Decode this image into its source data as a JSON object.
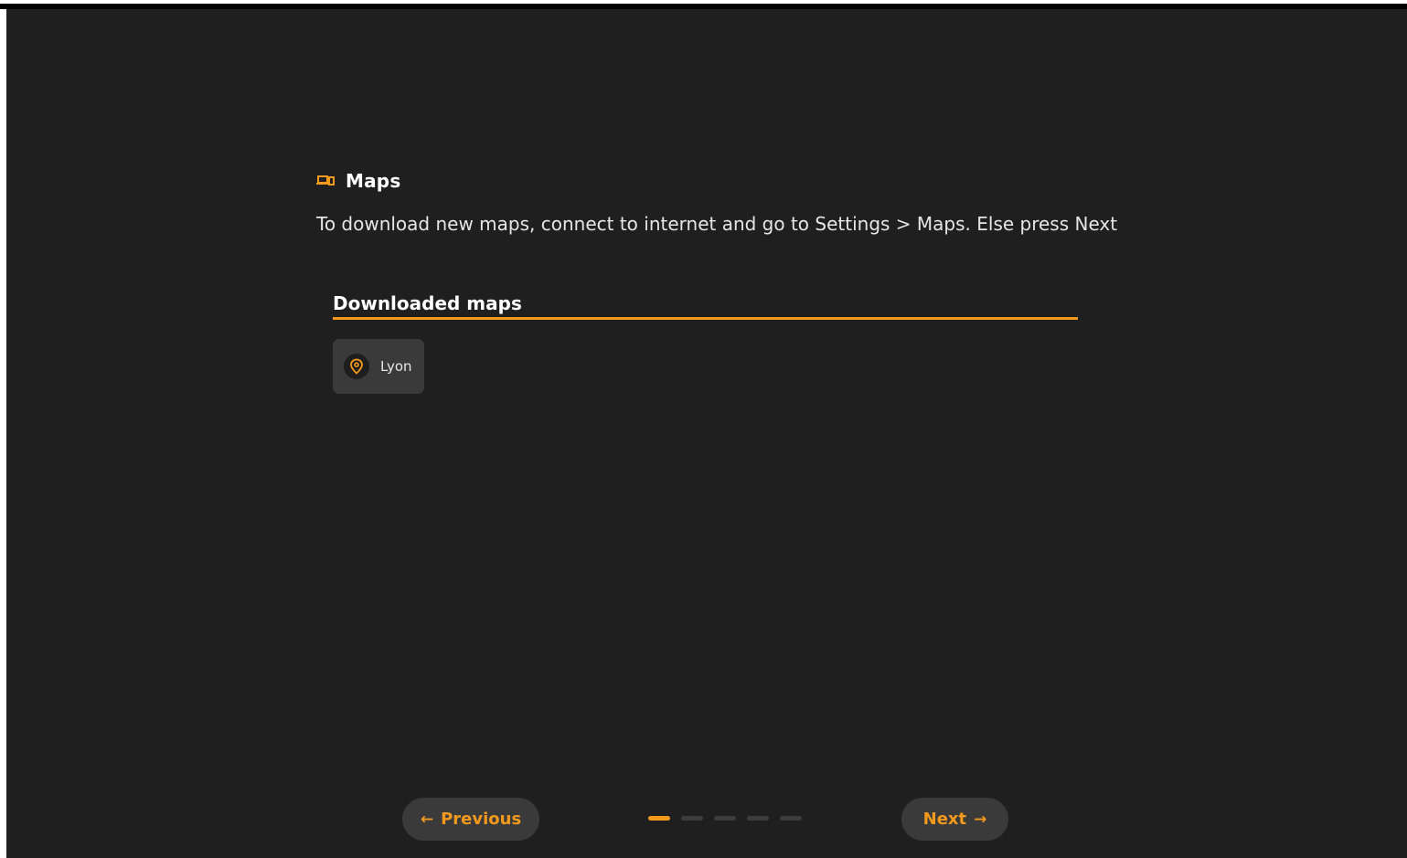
{
  "header": {
    "icon": "devices-icon",
    "title": "Maps"
  },
  "instructions": "To download new maps, connect to internet and go to Settings > Maps. Else press Next",
  "downloaded": {
    "title": "Downloaded maps",
    "items": [
      {
        "icon": "map-pin-icon",
        "label": "Lyon"
      }
    ]
  },
  "nav": {
    "previous_label": "Previous",
    "previous_icon": "arrow-left-icon",
    "previous_arrow": "←",
    "next_label": "Next",
    "next_icon": "arrow-right-icon",
    "next_arrow": "→",
    "steps_total": 5,
    "current_step": 1
  },
  "colors": {
    "accent": "#f39a1e",
    "background": "#1f1f1f",
    "surface": "#3a3a3a"
  }
}
